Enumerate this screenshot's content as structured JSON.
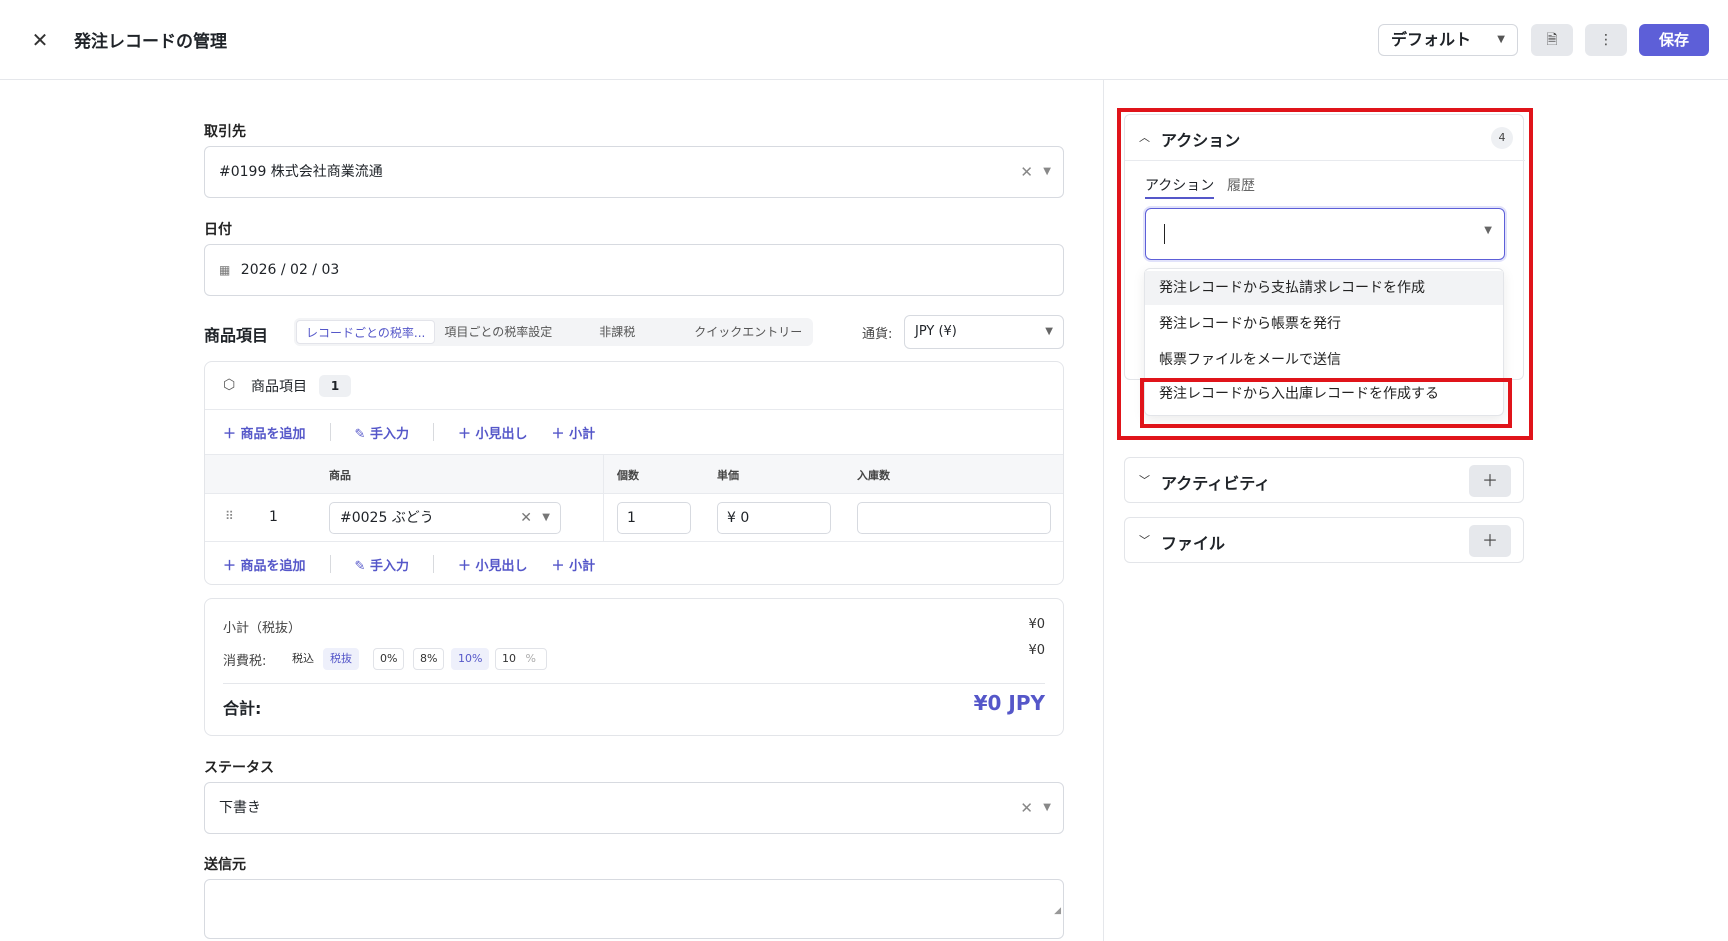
{
  "header": {
    "title": "発注レコードの管理",
    "view_select": "デフォルト",
    "save_label": "保存"
  },
  "form": {
    "partner": {
      "label": "取引先",
      "value": "#0199 株式会社商業流通"
    },
    "date": {
      "label": "日付",
      "value": "2026 / 02 / 03"
    },
    "items": {
      "heading": "商品項目",
      "tax_tabs": [
        "レコードごとの税率...",
        "項目ごとの税率設定",
        "非課税",
        "クイックエントリー"
      ],
      "currency_label": "通貨:",
      "currency_value": "JPY (¥)",
      "box_title": "商品項目",
      "box_count": "1",
      "toolbar": {
        "add_product": "商品を追加",
        "manual": "手入力",
        "subheading": "小見出し",
        "subtotal": "小計"
      },
      "columns": {
        "product": "商品",
        "qty": "個数",
        "unit_price": "単価",
        "received": "入庫数"
      },
      "rows": [
        {
          "num": "1",
          "product": "#0025 ぶどう",
          "qty": "1",
          "unit_price": "¥ 0",
          "received": ""
        }
      ]
    },
    "totals": {
      "subtotal_label": "小計（税抜）",
      "subtotal_value": "¥0",
      "tax_label": "消費税:",
      "tax_value": "¥0",
      "tax_mode_incl": "税込",
      "tax_mode_excl": "税抜",
      "rates": [
        "0%",
        "8%",
        "10%"
      ],
      "custom_rate": "10",
      "custom_rate_unit": "%",
      "grand_label": "合計:",
      "grand_value": "¥0 JPY"
    },
    "status": {
      "label": "ステータス",
      "value": "下書き"
    },
    "sender": {
      "label": "送信元",
      "value": ""
    }
  },
  "side": {
    "actions": {
      "title": "アクション",
      "count": "4",
      "tab_actions": "アクション",
      "tab_history": "履歴",
      "options": [
        "発注レコードから支払請求レコードを作成",
        "発注レコードから帳票を発行",
        "帳票ファイルをメールで送信",
        "発注レコードから入出庫レコードを作成する"
      ]
    },
    "activity_title": "アクティビティ",
    "files_title": "ファイル"
  },
  "colors": {
    "accent": "#5d5fd8",
    "highlight": "#e0141a"
  }
}
